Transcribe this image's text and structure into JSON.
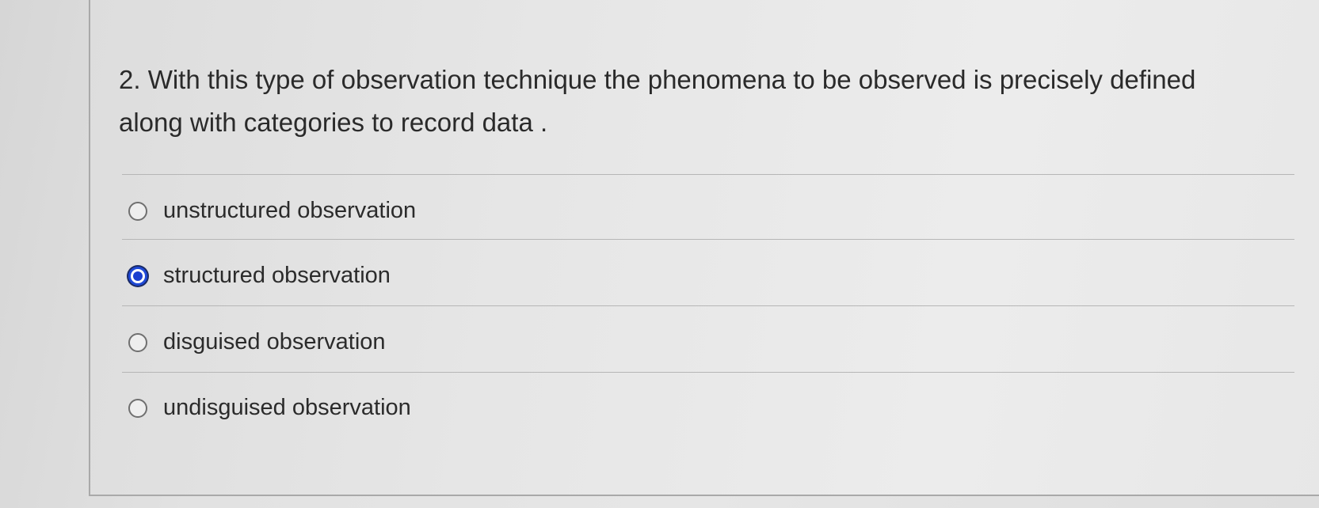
{
  "question": {
    "text": "2. With this type of observation technique the phenomena to be observed is precisely defined along with categories to record data ."
  },
  "options": [
    {
      "label": "unstructured observation",
      "selected": false
    },
    {
      "label": "structured observation",
      "selected": true
    },
    {
      "label": "disguised observation",
      "selected": false
    },
    {
      "label": "undisguised observation",
      "selected": false
    }
  ],
  "colors": {
    "selected_radio": "#1b3fd0",
    "radio_border": "#6f6f6f"
  }
}
